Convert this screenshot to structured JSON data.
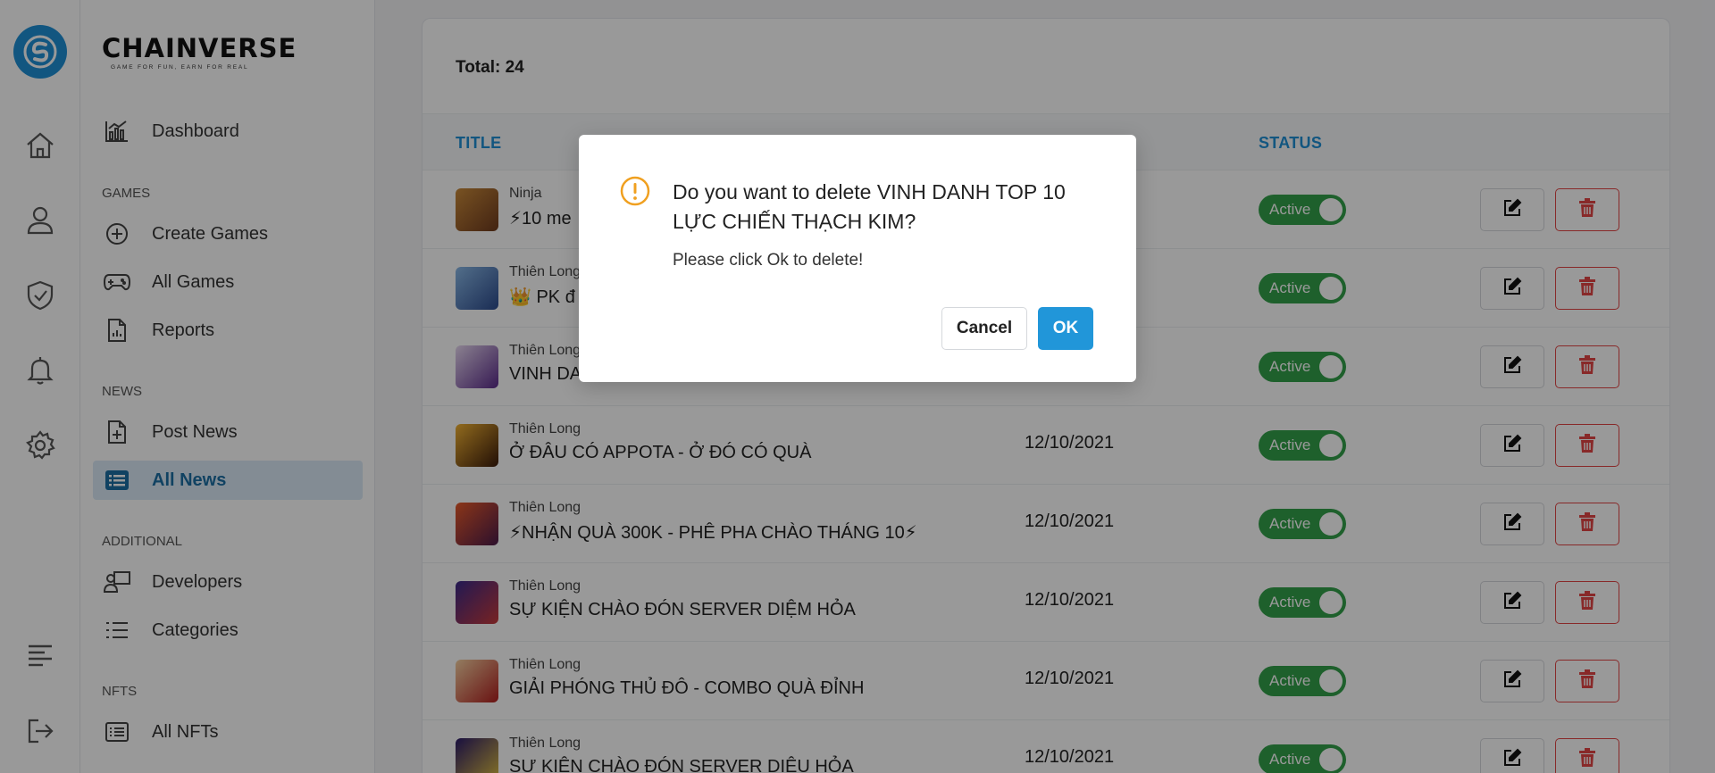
{
  "brand": {
    "name": "CHAINVERSE",
    "tagline": "GAME FOR FUN, EARN FOR REAL"
  },
  "rail": {
    "icons": [
      "app-logo-icon",
      "home-icon",
      "user-icon",
      "shield-check-icon",
      "bell-icon",
      "gear-icon",
      "menu-lines-icon",
      "logout-icon"
    ]
  },
  "sidebar": {
    "dashboard": "Dashboard",
    "games_header": "GAMES",
    "create_games": "Create Games",
    "all_games": "All Games",
    "reports": "Reports",
    "news_header": "NEWS",
    "post_news": "Post News",
    "all_news": "All News",
    "additional_header": "ADDITIONAL",
    "developers": "Developers",
    "categories": "Categories",
    "nfts_header": "NFTS",
    "all_nfts": "All NFTs"
  },
  "main": {
    "total": "Total: 24",
    "columns": {
      "title": "TITLE",
      "status": "STATUS"
    },
    "rows": [
      {
        "category": "Ninja",
        "title": "⚡10 me",
        "date": "",
        "status": "Active"
      },
      {
        "category": "Thiên Long",
        "title": "👑 PK đ",
        "date": "",
        "status": "Active"
      },
      {
        "category": "Thiên Long",
        "title": "VINH DANH TOP 10 LỰC CHIẾN THẠCH KIM",
        "date": "",
        "status": "Active"
      },
      {
        "category": "Thiên Long",
        "title": "Ở ĐÂU CÓ APPOTA - Ở ĐÓ CÓ QUÀ",
        "date": "12/10/2021",
        "status": "Active"
      },
      {
        "category": "Thiên Long",
        "title": "⚡NHẬN QUÀ 300K - PHÊ PHA CHÀO THÁNG 10⚡",
        "date": "12/10/2021",
        "status": "Active"
      },
      {
        "category": "Thiên Long",
        "title": "SỰ KIỆN CHÀO ĐÓN SERVER DIỆM HỎA",
        "date": "12/10/2021",
        "status": "Active"
      },
      {
        "category": "Thiên Long",
        "title": "GIẢI PHÓNG THỦ ĐÔ - COMBO QUÀ ĐỈNH",
        "date": "12/10/2021",
        "status": "Active"
      },
      {
        "category": "Thiên Long",
        "title": "SỰ KIỆN CHÀO ĐÓN SERVER DIỆU HỎA",
        "date": "12/10/2021",
        "status": "Active"
      }
    ]
  },
  "modal": {
    "question": "Do you want to delete VINH DANH TOP 10 LỰC CHIẾN THẠCH KIM?",
    "subtext": "Please click Ok to delete!",
    "cancel_label": "Cancel",
    "ok_label": "OK"
  },
  "colors": {
    "accent": "#1f8fd6",
    "active": "#33a04a",
    "danger": "#e34545",
    "warning": "#f0a020"
  }
}
